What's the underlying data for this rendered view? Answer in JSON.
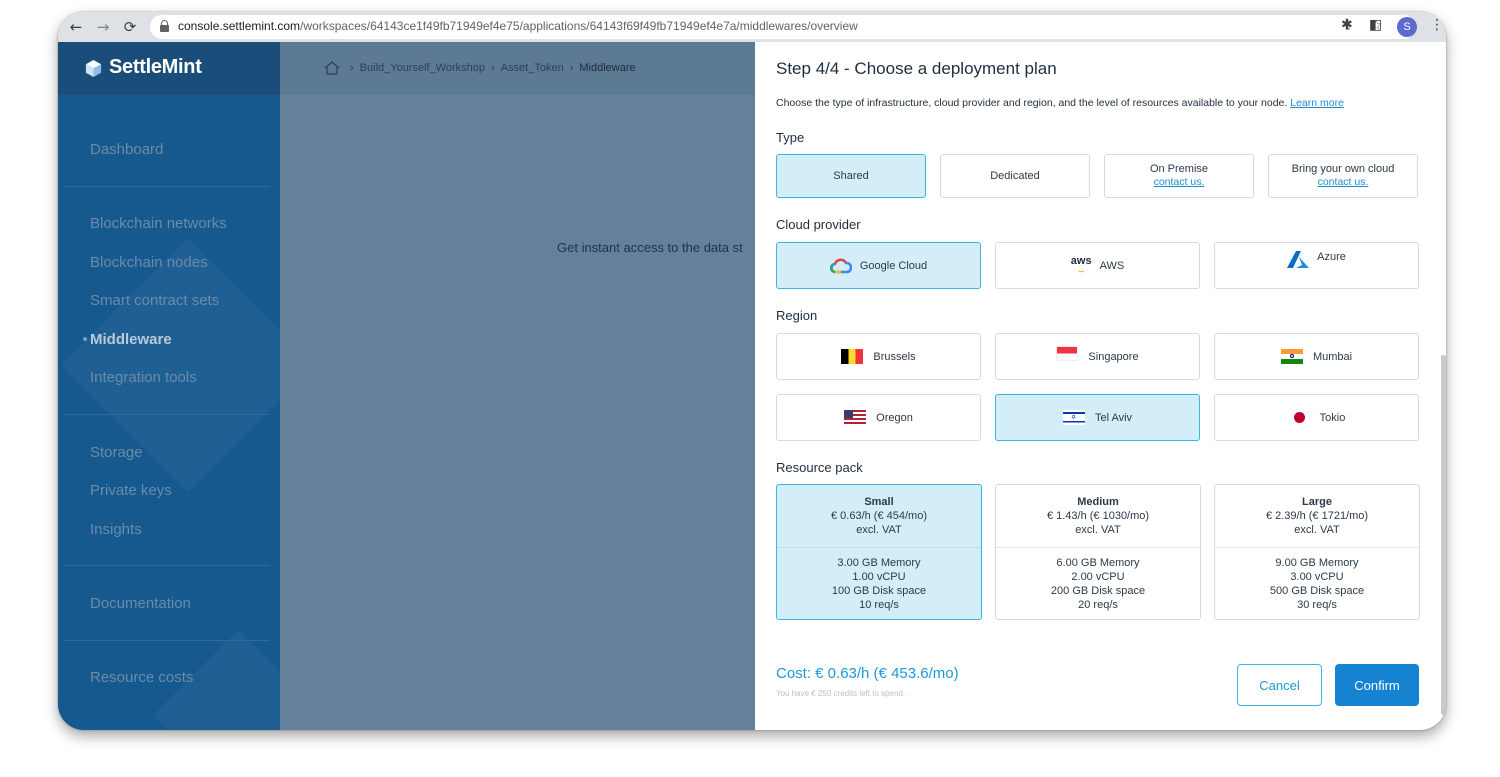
{
  "browser": {
    "url_host": "console.settlemint.com",
    "url_path": "/workspaces/64143ce1f49fb71949ef4e75/applications/64143f69f49fb71949ef4e7a/middlewares/overview",
    "profile_initial": "S"
  },
  "app": {
    "brand": "SettleMint",
    "breadcrumb": [
      "Build_Yourself_Workshop",
      "Asset_Token",
      "Middleware"
    ],
    "content_text": "Get instant access to the data st"
  },
  "sidebar": {
    "items": [
      {
        "label": "Dashboard"
      },
      {
        "label": "Blockchain networks"
      },
      {
        "label": "Blockchain nodes"
      },
      {
        "label": "Smart contract sets"
      },
      {
        "label": "Middleware",
        "active": true
      },
      {
        "label": "Integration tools"
      },
      {
        "label": "Storage"
      },
      {
        "label": "Private keys"
      },
      {
        "label": "Insights"
      },
      {
        "label": "Documentation"
      },
      {
        "label": "Resource costs"
      }
    ]
  },
  "panel": {
    "title": "Step 4/4 - Choose a deployment plan",
    "description": "Choose the type of infrastructure, cloud provider and region, and the level of resources available to your node.",
    "learn_more": "Learn more",
    "type_label": "Type",
    "types": [
      {
        "label": "Shared",
        "selected": true
      },
      {
        "label": "Dedicated"
      },
      {
        "label": "On Premise",
        "link": "contact us."
      },
      {
        "label": "Bring your own cloud",
        "link": "contact us."
      }
    ],
    "provider_label": "Cloud provider",
    "providers": [
      {
        "label": "Google Cloud",
        "icon": "google-cloud-icon",
        "selected": true
      },
      {
        "label": "AWS",
        "icon": "aws-icon",
        "icon_text": "aws"
      },
      {
        "label": "Azure",
        "icon": "azure-icon"
      }
    ],
    "region_label": "Region",
    "regions": [
      {
        "label": "Brussels",
        "icon": "belgium-flag-icon"
      },
      {
        "label": "Singapore",
        "icon": "singapore-flag-icon"
      },
      {
        "label": "Mumbai",
        "icon": "india-flag-icon"
      },
      {
        "label": "Oregon",
        "icon": "usa-flag-icon"
      },
      {
        "label": "Tel Aviv",
        "icon": "israel-flag-icon",
        "selected": true
      },
      {
        "label": "Tokio",
        "icon": "japan-flag-icon"
      }
    ],
    "resource_label": "Resource pack",
    "packs": [
      {
        "name": "Small",
        "price": "€ 0.63/h (€ 454/mo)",
        "vat": "excl. VAT",
        "memory": "3.00 GB Memory",
        "cpu": "1.00 vCPU",
        "disk": "100 GB Disk space",
        "rate": "10 req/s",
        "selected": true
      },
      {
        "name": "Medium",
        "price": "€ 1.43/h (€ 1030/mo)",
        "vat": "excl. VAT",
        "memory": "6.00 GB Memory",
        "cpu": "2.00 vCPU",
        "disk": "200 GB Disk space",
        "rate": "20 req/s"
      },
      {
        "name": "Large",
        "price": "€ 2.39/h (€ 1721/mo)",
        "vat": "excl. VAT",
        "memory": "9.00 GB Memory",
        "cpu": "3.00 vCPU",
        "disk": "500 GB Disk space",
        "rate": "30 req/s"
      }
    ],
    "cost": "Cost: € 0.63/h (€ 453.6/mo)",
    "credits": "You have € 250 credits left to spend.",
    "cancel": "Cancel",
    "confirm": "Confirm"
  },
  "colors": {
    "accent": "#1a9ad6",
    "selected_bg": "#d3eef9",
    "sidebar_bg": "#16598f",
    "confirm_bg": "#1583d1"
  }
}
